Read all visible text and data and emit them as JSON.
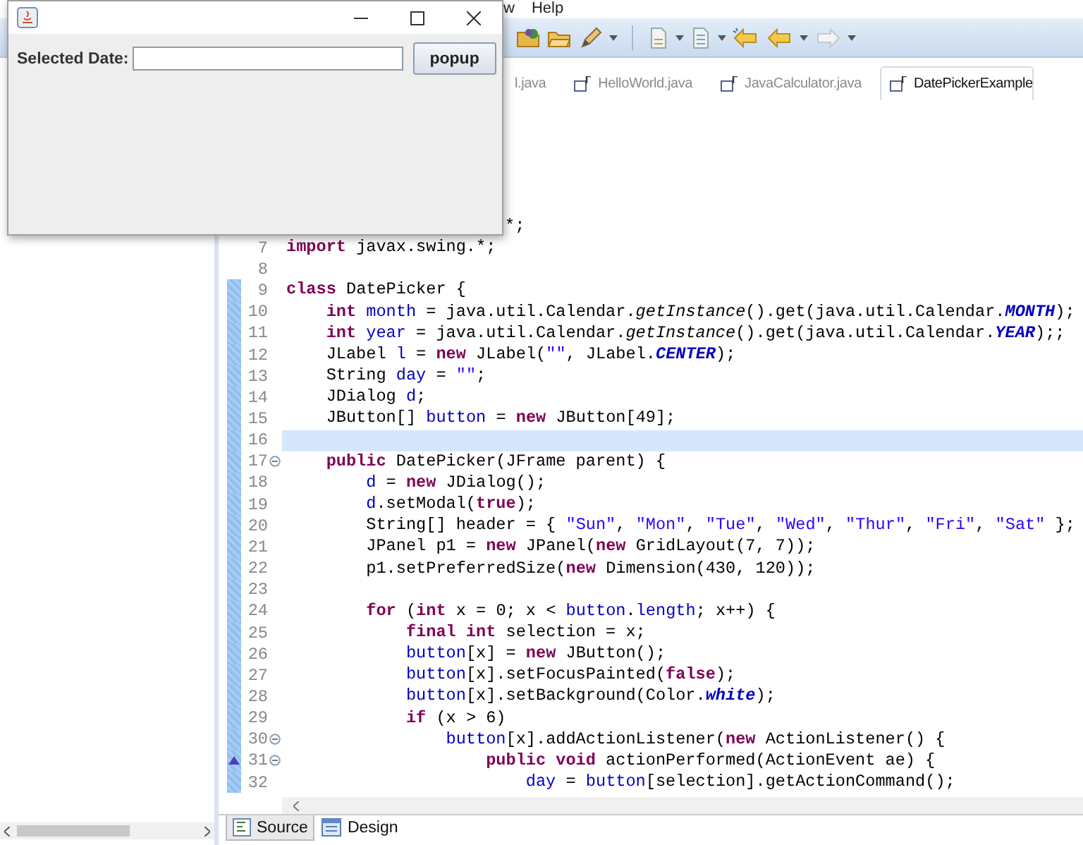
{
  "menu_bar": {
    "items": [
      "w",
      "Help"
    ]
  },
  "editor_tabs": [
    {
      "label": "l.java",
      "selected": false
    },
    {
      "label": "HelloWorld.java",
      "selected": false
    },
    {
      "label": "JavaCalculator.java",
      "selected": false
    },
    {
      "label": "DatePickerExample",
      "selected": true
    }
  ],
  "code_lines": [
    {
      "tokens": [
        {
          "text": "*;",
          "kind": "plain"
        }
      ]
    },
    {
      "number": "7",
      "marked": false,
      "current": false,
      "fold": false,
      "override": false,
      "tokens": [
        {
          "text": "import",
          "kind": "keyword"
        },
        {
          "text": " javax.swing.*;",
          "kind": "plain"
        }
      ]
    },
    {
      "number": "8",
      "marked": false,
      "current": false,
      "fold": false,
      "override": false
    },
    {
      "number": "9",
      "marked": true,
      "current": false,
      "fold": false,
      "override": false,
      "tokens": [
        {
          "text": "class",
          "kind": "keyword"
        },
        {
          "text": " DatePicker {",
          "kind": "plain"
        }
      ]
    },
    {
      "number": "10",
      "marked": true,
      "current": false,
      "fold": false,
      "override": false,
      "tokens": [
        {
          "text": "    int",
          "kind": "keyword"
        },
        {
          "text": " month",
          "kind": "field"
        },
        {
          "text": " = java.util.Calendar.",
          "kind": "plain"
        },
        {
          "text": "getInstance",
          "kind": "static"
        },
        {
          "text": "().get(java.util.Calendar.",
          "kind": "plain"
        },
        {
          "text": "MONTH",
          "kind": "constant"
        },
        {
          "text": ");",
          "kind": "plain"
        }
      ]
    },
    {
      "number": "11",
      "marked": true,
      "current": false,
      "fold": false,
      "override": false,
      "tokens": [
        {
          "text": "    int",
          "kind": "keyword"
        },
        {
          "text": " year",
          "kind": "field"
        },
        {
          "text": " = java.util.Calendar.",
          "kind": "plain"
        },
        {
          "text": "getInstance",
          "kind": "static"
        },
        {
          "text": "().get(java.util.Calendar.",
          "kind": "plain"
        },
        {
          "text": "YEAR",
          "kind": "constant"
        },
        {
          "text": ");;",
          "kind": "plain"
        }
      ]
    },
    {
      "number": "12",
      "marked": true,
      "current": false,
      "fold": false,
      "override": false,
      "tokens": [
        {
          "text": "    JLabel ",
          "kind": "plain"
        },
        {
          "text": "l",
          "kind": "field"
        },
        {
          "text": " = ",
          "kind": "plain"
        },
        {
          "text": "new",
          "kind": "keyword"
        },
        {
          "text": " JLabel(",
          "kind": "plain"
        },
        {
          "text": "\"\"",
          "kind": "string"
        },
        {
          "text": ", JLabel.",
          "kind": "plain"
        },
        {
          "text": "CENTER",
          "kind": "constant"
        },
        {
          "text": ");",
          "kind": "plain"
        }
      ]
    },
    {
      "number": "13",
      "marked": true,
      "current": false,
      "fold": false,
      "override": false,
      "tokens": [
        {
          "text": "    String ",
          "kind": "plain"
        },
        {
          "text": "day",
          "kind": "field"
        },
        {
          "text": " = ",
          "kind": "plain"
        },
        {
          "text": "\"\"",
          "kind": "string"
        },
        {
          "text": ";",
          "kind": "plain"
        }
      ]
    },
    {
      "number": "14",
      "marked": true,
      "current": false,
      "fold": false,
      "override": false,
      "tokens": [
        {
          "text": "    JDialog ",
          "kind": "plain"
        },
        {
          "text": "d",
          "kind": "field"
        },
        {
          "text": ";",
          "kind": "plain"
        }
      ]
    },
    {
      "number": "15",
      "marked": true,
      "current": false,
      "fold": false,
      "override": false,
      "tokens": [
        {
          "text": "    JButton[] ",
          "kind": "plain"
        },
        {
          "text": "button",
          "kind": "field"
        },
        {
          "text": " = ",
          "kind": "plain"
        },
        {
          "text": "new",
          "kind": "keyword"
        },
        {
          "text": " JButton[49];",
          "kind": "plain"
        }
      ]
    },
    {
      "number": "16",
      "marked": true,
      "current": true,
      "fold": false,
      "override": false
    },
    {
      "number": "17",
      "marked": true,
      "current": false,
      "fold": true,
      "override": false,
      "tokens": [
        {
          "text": "    public",
          "kind": "keyword"
        },
        {
          "text": " DatePicker(JFrame parent) {",
          "kind": "plain"
        }
      ]
    },
    {
      "number": "18",
      "marked": true,
      "current": false,
      "fold": false,
      "override": false,
      "tokens": [
        {
          "text": "        d",
          "kind": "field"
        },
        {
          "text": " = ",
          "kind": "plain"
        },
        {
          "text": "new",
          "kind": "keyword"
        },
        {
          "text": " JDialog();",
          "kind": "plain"
        }
      ]
    },
    {
      "number": "19",
      "marked": true,
      "current": false,
      "fold": false,
      "override": false,
      "tokens": [
        {
          "text": "        d",
          "kind": "field"
        },
        {
          "text": ".setModal(",
          "kind": "plain"
        },
        {
          "text": "true",
          "kind": "keyword"
        },
        {
          "text": ");",
          "kind": "plain"
        }
      ]
    },
    {
      "number": "20",
      "marked": true,
      "current": false,
      "fold": false,
      "override": false,
      "tokens": [
        {
          "text": "        String[] header = { ",
          "kind": "plain"
        },
        {
          "text": "\"Sun\"",
          "kind": "string"
        },
        {
          "text": ", ",
          "kind": "plain"
        },
        {
          "text": "\"Mon\"",
          "kind": "string"
        },
        {
          "text": ", ",
          "kind": "plain"
        },
        {
          "text": "\"Tue\"",
          "kind": "string"
        },
        {
          "text": ", ",
          "kind": "plain"
        },
        {
          "text": "\"Wed\"",
          "kind": "string"
        },
        {
          "text": ", ",
          "kind": "plain"
        },
        {
          "text": "\"Thur\"",
          "kind": "string"
        },
        {
          "text": ", ",
          "kind": "plain"
        },
        {
          "text": "\"Fri\"",
          "kind": "string"
        },
        {
          "text": ", ",
          "kind": "plain"
        },
        {
          "text": "\"Sat\"",
          "kind": "string"
        },
        {
          "text": " };",
          "kind": "plain"
        }
      ]
    },
    {
      "number": "21",
      "marked": true,
      "current": false,
      "fold": false,
      "override": false,
      "tokens": [
        {
          "text": "        JPanel p1 = ",
          "kind": "plain"
        },
        {
          "text": "new",
          "kind": "keyword"
        },
        {
          "text": " JPanel(",
          "kind": "plain"
        },
        {
          "text": "new",
          "kind": "keyword"
        },
        {
          "text": " GridLayout(7, 7));",
          "kind": "plain"
        }
      ]
    },
    {
      "number": "22",
      "marked": true,
      "current": false,
      "fold": false,
      "override": false,
      "tokens": [
        {
          "text": "        p1.setPreferredSize(",
          "kind": "plain"
        },
        {
          "text": "new",
          "kind": "keyword"
        },
        {
          "text": " Dimension(430, 120));",
          "kind": "plain"
        }
      ]
    },
    {
      "number": "23",
      "marked": true,
      "current": false,
      "fold": false,
      "override": false
    },
    {
      "number": "24",
      "marked": true,
      "current": false,
      "fold": false,
      "override": false,
      "tokens": [
        {
          "text": "        for",
          "kind": "keyword"
        },
        {
          "text": " (",
          "kind": "plain"
        },
        {
          "text": "int",
          "kind": "keyword"
        },
        {
          "text": " x = 0; x < ",
          "kind": "plain"
        },
        {
          "text": "button",
          "kind": "field"
        },
        {
          "text": ".",
          "kind": "plain"
        },
        {
          "text": "length",
          "kind": "field"
        },
        {
          "text": "; x++) {",
          "kind": "plain"
        }
      ]
    },
    {
      "number": "25",
      "marked": true,
      "current": false,
      "fold": false,
      "override": false,
      "tokens": [
        {
          "text": "            final int",
          "kind": "keyword"
        },
        {
          "text": " selection = x;",
          "kind": "plain"
        }
      ]
    },
    {
      "number": "26",
      "marked": true,
      "current": false,
      "fold": false,
      "override": false,
      "tokens": [
        {
          "text": "            button",
          "kind": "field"
        },
        {
          "text": "[x] = ",
          "kind": "plain"
        },
        {
          "text": "new",
          "kind": "keyword"
        },
        {
          "text": " JButton();",
          "kind": "plain"
        }
      ]
    },
    {
      "number": "27",
      "marked": true,
      "current": false,
      "fold": false,
      "override": false,
      "tokens": [
        {
          "text": "            button",
          "kind": "field"
        },
        {
          "text": "[x].setFocusPainted(",
          "kind": "plain"
        },
        {
          "text": "false",
          "kind": "keyword"
        },
        {
          "text": ");",
          "kind": "plain"
        }
      ]
    },
    {
      "number": "28",
      "marked": true,
      "current": false,
      "fold": false,
      "override": false,
      "tokens": [
        {
          "text": "            button",
          "kind": "field"
        },
        {
          "text": "[x].setBackground(Color.",
          "kind": "plain"
        },
        {
          "text": "white",
          "kind": "constant"
        },
        {
          "text": ");",
          "kind": "plain"
        }
      ]
    },
    {
      "number": "29",
      "marked": true,
      "current": false,
      "fold": false,
      "override": false,
      "tokens": [
        {
          "text": "            if",
          "kind": "keyword"
        },
        {
          "text": " (x > 6)",
          "kind": "plain"
        }
      ]
    },
    {
      "number": "30",
      "marked": true,
      "current": false,
      "fold": true,
      "override": false,
      "tokens": [
        {
          "text": "                button",
          "kind": "field"
        },
        {
          "text": "[x].addActionListener(",
          "kind": "plain"
        },
        {
          "text": "new",
          "kind": "keyword"
        },
        {
          "text": " ActionListener() {",
          "kind": "plain"
        }
      ]
    },
    {
      "number": "31",
      "marked": true,
      "current": false,
      "fold": true,
      "override": true,
      "tokens": [
        {
          "text": "                    public void",
          "kind": "keyword"
        },
        {
          "text": " actionPerformed(ActionEvent ae) {",
          "kind": "plain"
        }
      ]
    },
    {
      "number": "32",
      "marked": true,
      "current": false,
      "fold": false,
      "override": false,
      "tokens": [
        {
          "text": "                        day",
          "kind": "field"
        },
        {
          "text": " = ",
          "kind": "plain"
        },
        {
          "text": "button",
          "kind": "field"
        },
        {
          "text": "[selection].getActionCommand();",
          "kind": "plain"
        }
      ]
    }
  ],
  "bottom_tabs": [
    {
      "label": "Source",
      "selected": true
    },
    {
      "label": "Design",
      "selected": false
    }
  ],
  "swing_window": {
    "field_label": "Selected Date:",
    "button": "popup"
  }
}
